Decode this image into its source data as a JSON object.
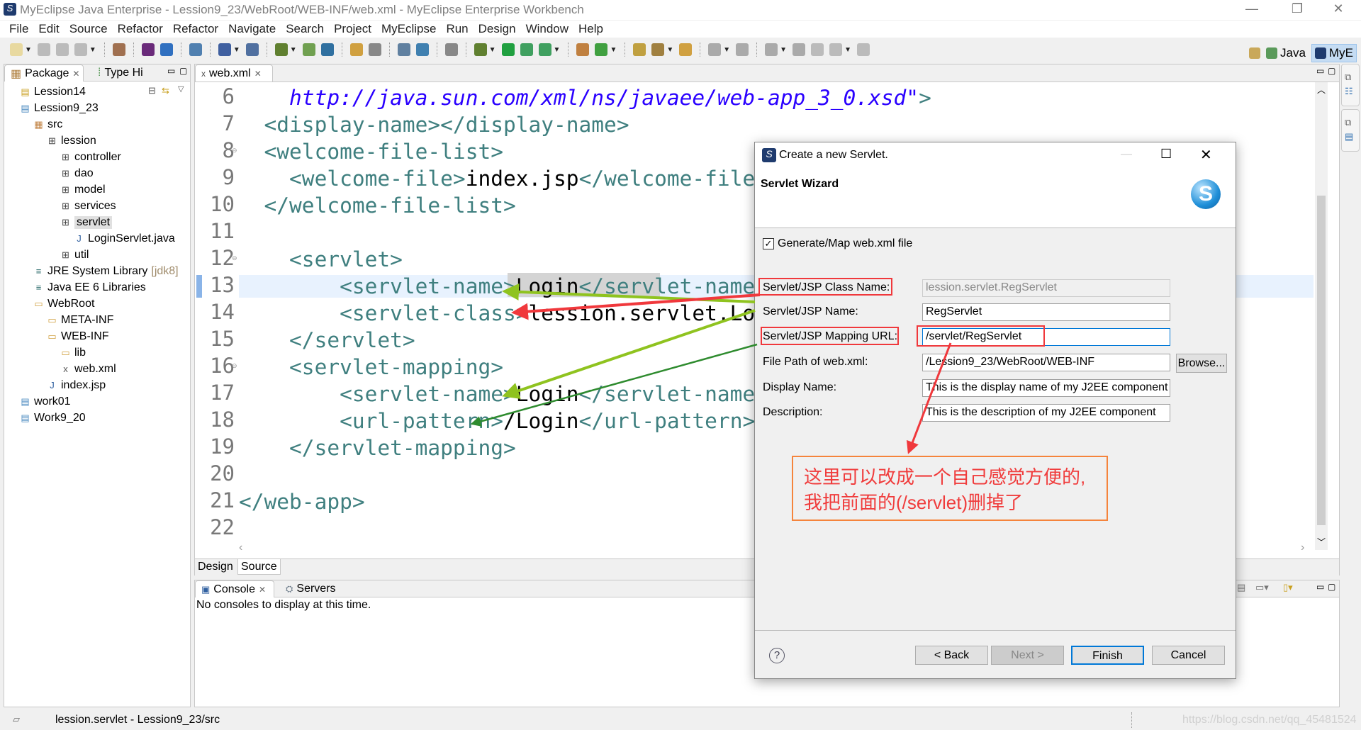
{
  "window": {
    "title": "MyEclipse Java Enterprise - Lession9_23/WebRoot/WEB-INF/web.xml - MyEclipse Enterprise Workbench"
  },
  "menu": [
    "File",
    "Edit",
    "Source",
    "Refactor",
    "Refactor",
    "Navigate",
    "Search",
    "Project",
    "MyEclipse",
    "Run",
    "Design",
    "Window",
    "Help"
  ],
  "perspectives": {
    "java": "Java",
    "myeclipse": "MyE"
  },
  "left_panel": {
    "tabs": [
      {
        "label": "Package"
      },
      {
        "label": "Type Hi"
      }
    ],
    "tree": [
      {
        "label": "Lession14",
        "level": 0,
        "icon": "project-icon"
      },
      {
        "label": "Lession9_23",
        "level": 0,
        "icon": "web-project-icon"
      },
      {
        "label": "src",
        "level": 1,
        "icon": "source-folder-icon"
      },
      {
        "label": "lession",
        "level": 2,
        "icon": "package-icon"
      },
      {
        "label": "controller",
        "level": 3,
        "icon": "package-icon"
      },
      {
        "label": "dao",
        "level": 3,
        "icon": "package-icon"
      },
      {
        "label": "model",
        "level": 3,
        "icon": "package-icon"
      },
      {
        "label": "services",
        "level": 3,
        "icon": "package-icon"
      },
      {
        "label": "servlet",
        "level": 3,
        "icon": "package-icon",
        "selected": true
      },
      {
        "label": "LoginServlet.java",
        "level": 4,
        "icon": "java-file-icon"
      },
      {
        "label": "util",
        "level": 3,
        "icon": "package-icon"
      },
      {
        "label": "JRE System Library",
        "suffix": "[jdk8]",
        "level": 1,
        "icon": "library-icon"
      },
      {
        "label": "Java EE 6 Libraries",
        "level": 1,
        "icon": "library-icon"
      },
      {
        "label": "WebRoot",
        "level": 1,
        "icon": "folder-icon"
      },
      {
        "label": "META-INF",
        "level": 2,
        "icon": "folder-icon"
      },
      {
        "label": "WEB-INF",
        "level": 2,
        "icon": "folder-icon"
      },
      {
        "label": "lib",
        "level": 3,
        "icon": "folder-icon"
      },
      {
        "label": "web.xml",
        "level": 3,
        "icon": "xml-file-icon"
      },
      {
        "label": "index.jsp",
        "level": 2,
        "icon": "jsp-file-icon"
      },
      {
        "label": "work01",
        "level": 0,
        "icon": "web-project-icon"
      },
      {
        "label": "Work9_20",
        "level": 0,
        "icon": "web-project-icon"
      }
    ]
  },
  "editor": {
    "tab": "web.xml",
    "current_line": "13",
    "lines": [
      {
        "n": "6",
        "tokens": [
          {
            "c": "url",
            "v": "    http://java.sun.com/xml/ns/javaee/web-app_3_0.xsd\""
          },
          {
            "c": "tag",
            "v": ">"
          }
        ]
      },
      {
        "n": "7",
        "tokens": [
          {
            "c": "tag",
            "v": "  <display-name></display-name>"
          }
        ]
      },
      {
        "n": "8",
        "tokens": [
          {
            "c": "tag",
            "v": "  <welcome-file-list>"
          }
        ]
      },
      {
        "n": "9",
        "tokens": [
          {
            "c": "tag",
            "v": "    <welcome-file>"
          },
          {
            "c": "txt",
            "v": "index.jsp"
          },
          {
            "c": "tag",
            "v": "</welcome-file"
          }
        ]
      },
      {
        "n": "10",
        "tokens": [
          {
            "c": "tag",
            "v": "  </welcome-file-list>"
          }
        ]
      },
      {
        "n": "11",
        "tokens": []
      },
      {
        "n": "12",
        "tokens": [
          {
            "c": "tag",
            "v": "    <servlet>"
          }
        ]
      },
      {
        "n": "13",
        "tokens": [
          {
            "c": "tag",
            "v": "        <servlet-name>"
          },
          {
            "c": "txt",
            "v": "Login"
          },
          {
            "c": "tag",
            "v": "</servlet-name"
          }
        ]
      },
      {
        "n": "14",
        "tokens": [
          {
            "c": "tag",
            "v": "        <servlet-class>"
          },
          {
            "c": "txt",
            "v": "lession.servlet.Lo"
          }
        ]
      },
      {
        "n": "15",
        "tokens": [
          {
            "c": "tag",
            "v": "    </servlet>"
          }
        ]
      },
      {
        "n": "16",
        "tokens": [
          {
            "c": "tag",
            "v": "    <servlet-mapping>"
          }
        ]
      },
      {
        "n": "17",
        "tokens": [
          {
            "c": "tag",
            "v": "        <servlet-name>"
          },
          {
            "c": "txt",
            "v": "Login"
          },
          {
            "c": "tag",
            "v": "</servlet-name"
          }
        ]
      },
      {
        "n": "18",
        "tokens": [
          {
            "c": "tag",
            "v": "        <url-pattern>"
          },
          {
            "c": "txt",
            "v": "/Login"
          },
          {
            "c": "tag",
            "v": "</url-pattern>"
          }
        ]
      },
      {
        "n": "19",
        "tokens": [
          {
            "c": "tag",
            "v": "    </servlet-mapping>"
          }
        ]
      },
      {
        "n": "20",
        "tokens": []
      },
      {
        "n": "21",
        "tokens": [
          {
            "c": "tag",
            "v": "</web-app>"
          }
        ]
      },
      {
        "n": "22",
        "tokens": []
      }
    ],
    "bottom_tabs": [
      "Design",
      "Source"
    ]
  },
  "console": {
    "tabs": [
      "Console",
      "Servers"
    ],
    "message": "No consoles to display at this time."
  },
  "status": {
    "text": "lession.servlet - Lession9_23/src",
    "watermark": "https://blog.csdn.net/qq_45481524"
  },
  "dialog": {
    "title": "Create a new Servlet.",
    "header": "Servlet Wizard",
    "generate_checkbox": {
      "label": "Generate/Map web.xml file",
      "checked": true
    },
    "fields": [
      {
        "label": "Servlet/JSP Class Name:",
        "value": "lession.servlet.RegServlet",
        "disabled": true
      },
      {
        "label": "Servlet/JSP Name:",
        "value": "RegServlet"
      },
      {
        "label": "Servlet/JSP Mapping URL:",
        "value": "/servlet/RegServlet",
        "focused": true
      },
      {
        "label": "File Path of web.xml:",
        "value": "/Lession9_23/WebRoot/WEB-INF"
      },
      {
        "label": "Display Name:",
        "value": "This is the display name of my J2EE component"
      },
      {
        "label": "Description:",
        "value": "This is the description of my J2EE component"
      }
    ],
    "browse": "Browse...",
    "buttons": {
      "back": "< Back",
      "next": "Next >",
      "finish": "Finish",
      "cancel": "Cancel"
    }
  },
  "annotation": {
    "line1": "这里可以改成一个自己感觉方便的,",
    "line2": "我把前面的(/servlet)删掉了",
    "color": "#f03c3c",
    "border": "#f5843c"
  },
  "colors": {
    "tag": "#3f7f7f",
    "url": "#2a00ff",
    "accent": "#0078d7",
    "arrow_lime": "#8fc31f",
    "arrow_green": "#2e8b2e",
    "arrow_red": "#f0383c"
  }
}
